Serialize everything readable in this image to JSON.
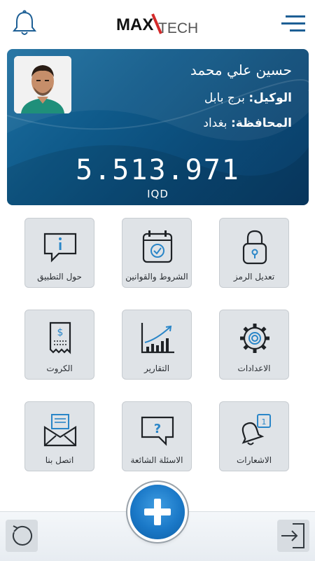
{
  "header": {
    "logo": {
      "part1": "MAX",
      "part2": "TECH"
    }
  },
  "profile": {
    "name": "حسين علي محمد",
    "agent_label": "الوكيل:",
    "agent_value": "برج بابل",
    "province_label": "المحافظة:",
    "province_value": "بغداد",
    "balance": "5.513.971",
    "currency": "IQD"
  },
  "tiles": [
    {
      "label": "تعديل الرمز",
      "icon": "lock-icon"
    },
    {
      "label": "الشروط والقوانين",
      "icon": "calendar-check-icon"
    },
    {
      "label": "حول التطبيق",
      "icon": "info-chat-icon"
    },
    {
      "label": "الاعدادات",
      "icon": "gear-icon"
    },
    {
      "label": "التقارير",
      "icon": "chart-icon"
    },
    {
      "label": "الكروت",
      "icon": "receipt-icon"
    },
    {
      "label": "الاشعارات",
      "icon": "bell-notification-icon",
      "badge": "1"
    },
    {
      "label": "الاسئلة الشائعة",
      "icon": "question-chat-icon"
    },
    {
      "label": "اتصل بنا",
      "icon": "mail-icon"
    }
  ],
  "colors": {
    "accent": "#1a78c7",
    "card": "#0f5a8a",
    "tile": "#dfe3e7"
  }
}
